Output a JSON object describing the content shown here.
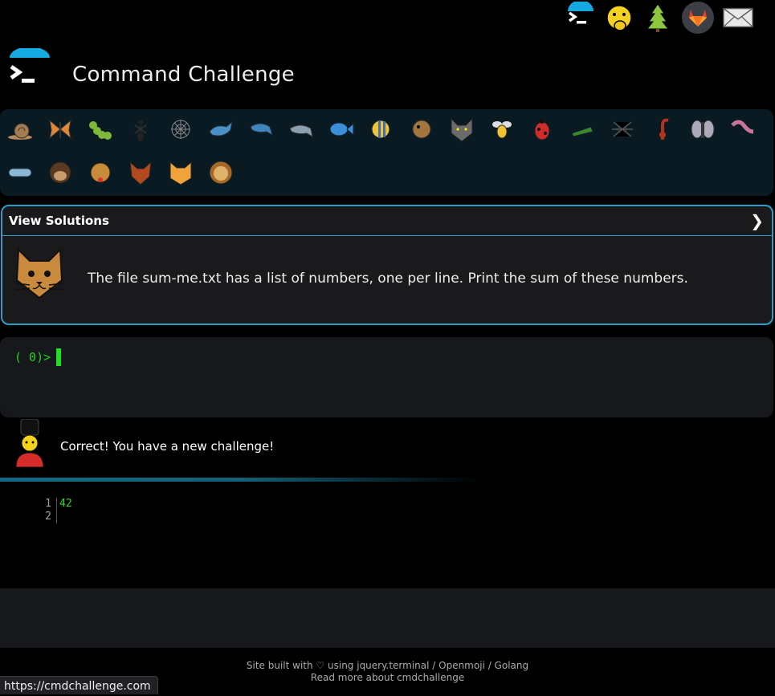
{
  "header": {
    "title": "Command Challenge",
    "nav_icons": [
      "terminal-icon",
      "hand-over-mouth-icon",
      "evergreen-tree-icon",
      "gitlab-icon",
      "envelope-icon"
    ]
  },
  "animal_bar": {
    "items": [
      "snail",
      "butterfly",
      "caterpillar",
      "ant",
      "spider-web",
      "whale",
      "dolphin",
      "dolphin",
      "fish",
      "tropical-fish",
      "blowfish",
      "wolf",
      "bee",
      "lady-beetle",
      "cricket",
      "spider",
      "scorpion",
      "fly",
      "worm",
      "microbe",
      "monkey",
      "dog",
      "fox",
      "cat",
      "lion"
    ]
  },
  "solution": {
    "toggle_label": "View Solutions",
    "chevron": "❯",
    "challenge_text": "The file sum-me.txt has a list of numbers, one per line. Print the sum of these numbers."
  },
  "terminal": {
    "prompt": "( 0)>"
  },
  "feedback": {
    "message": "Correct! You have a new challenge!"
  },
  "code": {
    "line_numbers": "1\n2",
    "content": "42\n"
  },
  "footer": {
    "line1_prefix": "Site built with ♡ using ",
    "link_jquery": "jquery.terminal",
    "sep1": " / ",
    "link_openmoji": "Openmoji",
    "sep2": " / ",
    "link_golang": "Golang",
    "line2": "Read more about cmdchallenge"
  },
  "status_bar": {
    "url": "https://cmdchallenge.com"
  },
  "colors": {
    "accent": "#2a9fc7",
    "terminal_green": "#22d022",
    "panel": "#17181b"
  }
}
